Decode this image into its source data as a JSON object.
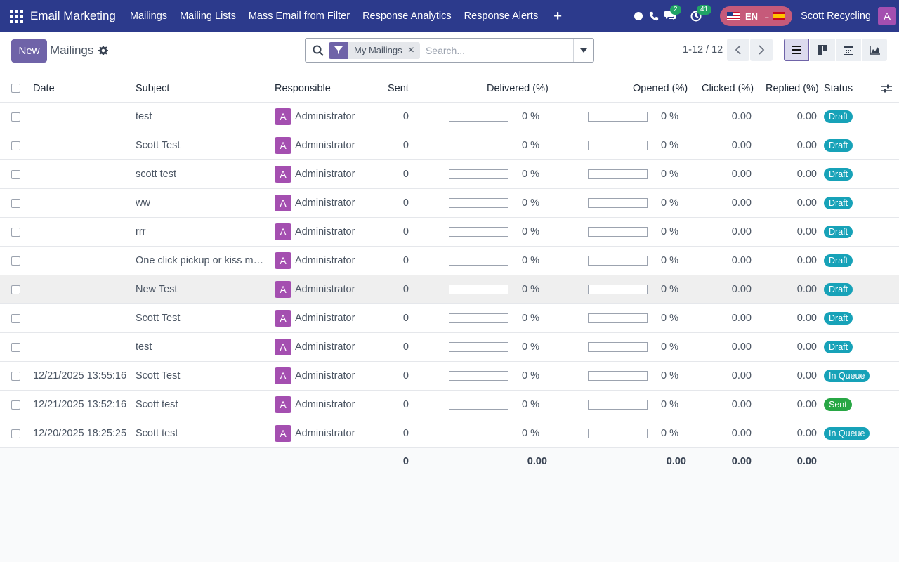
{
  "navbar": {
    "brand": "Email Marketing",
    "menu": [
      "Mailings",
      "Mailing Lists",
      "Mass Email from Filter",
      "Response Analytics",
      "Response Alerts"
    ],
    "messages_count": "2",
    "activities_count": "41",
    "lang_code": "EN",
    "company": "Scott Recycling",
    "user_initial": "A",
    "color": "#2c3a8c"
  },
  "control": {
    "new_label": "New",
    "breadcrumb": "Mailings",
    "facet_label": "My Mailings",
    "search_placeholder": "Search...",
    "pager": "1-12 / 12",
    "accent": "#6f63a8"
  },
  "table": {
    "headers": {
      "date": "Date",
      "subject": "Subject",
      "responsible": "Responsible",
      "sent": "Sent",
      "delivered": "Delivered (%)",
      "opened": "Opened (%)",
      "clicked": "Clicked (%)",
      "replied": "Replied (%)",
      "status": "Status"
    },
    "rows": [
      {
        "date": "",
        "subject": "test",
        "responsible": "Administrator",
        "sent": "0",
        "delivered": "0 %",
        "opened": "0 %",
        "clicked": "0.00",
        "replied": "0.00",
        "status": "Draft"
      },
      {
        "date": "",
        "subject": "Scott Test",
        "responsible": "Administrator",
        "sent": "0",
        "delivered": "0 %",
        "opened": "0 %",
        "clicked": "0.00",
        "replied": "0.00",
        "status": "Draft"
      },
      {
        "date": "",
        "subject": "scott test",
        "responsible": "Administrator",
        "sent": "0",
        "delivered": "0 %",
        "opened": "0 %",
        "clicked": "0.00",
        "replied": "0.00",
        "status": "Draft"
      },
      {
        "date": "",
        "subject": "ww",
        "responsible": "Administrator",
        "sent": "0",
        "delivered": "0 %",
        "opened": "0 %",
        "clicked": "0.00",
        "replied": "0.00",
        "status": "Draft"
      },
      {
        "date": "",
        "subject": "rrr",
        "responsible": "Administrator",
        "sent": "0",
        "delivered": "0 %",
        "opened": "0 %",
        "clicked": "0.00",
        "replied": "0.00",
        "status": "Draft"
      },
      {
        "date": "",
        "subject": "One click pickup or kiss my ...",
        "responsible": "Administrator",
        "sent": "0",
        "delivered": "0 %",
        "opened": "0 %",
        "clicked": "0.00",
        "replied": "0.00",
        "status": "Draft"
      },
      {
        "date": "",
        "subject": "New Test",
        "responsible": "Administrator",
        "sent": "0",
        "delivered": "0 %",
        "opened": "0 %",
        "clicked": "0.00",
        "replied": "0.00",
        "status": "Draft"
      },
      {
        "date": "",
        "subject": "Scott Test",
        "responsible": "Administrator",
        "sent": "0",
        "delivered": "0 %",
        "opened": "0 %",
        "clicked": "0.00",
        "replied": "0.00",
        "status": "Draft"
      },
      {
        "date": "",
        "subject": "test",
        "responsible": "Administrator",
        "sent": "0",
        "delivered": "0 %",
        "opened": "0 %",
        "clicked": "0.00",
        "replied": "0.00",
        "status": "Draft"
      },
      {
        "date": "12/21/2025 13:55:16",
        "subject": "Scott Test",
        "responsible": "Administrator",
        "sent": "0",
        "delivered": "0 %",
        "opened": "0 %",
        "clicked": "0.00",
        "replied": "0.00",
        "status": "In Queue"
      },
      {
        "date": "12/21/2025 13:52:16",
        "subject": "Scott test",
        "responsible": "Administrator",
        "sent": "0",
        "delivered": "0 %",
        "opened": "0 %",
        "clicked": "0.00",
        "replied": "0.00",
        "status": "Sent"
      },
      {
        "date": "12/20/2025 18:25:25",
        "subject": "Scott test",
        "responsible": "Administrator",
        "sent": "0",
        "delivered": "0 %",
        "opened": "0 %",
        "clicked": "0.00",
        "replied": "0.00",
        "status": "In Queue"
      }
    ],
    "totals": {
      "sent": "0",
      "delivered": "0.00",
      "opened": "0.00",
      "clicked": "0.00",
      "replied": "0.00"
    },
    "status_colors": {
      "Draft": "#17a2b8",
      "In Queue": "#17a2b8",
      "Sent": "#28a745"
    }
  }
}
